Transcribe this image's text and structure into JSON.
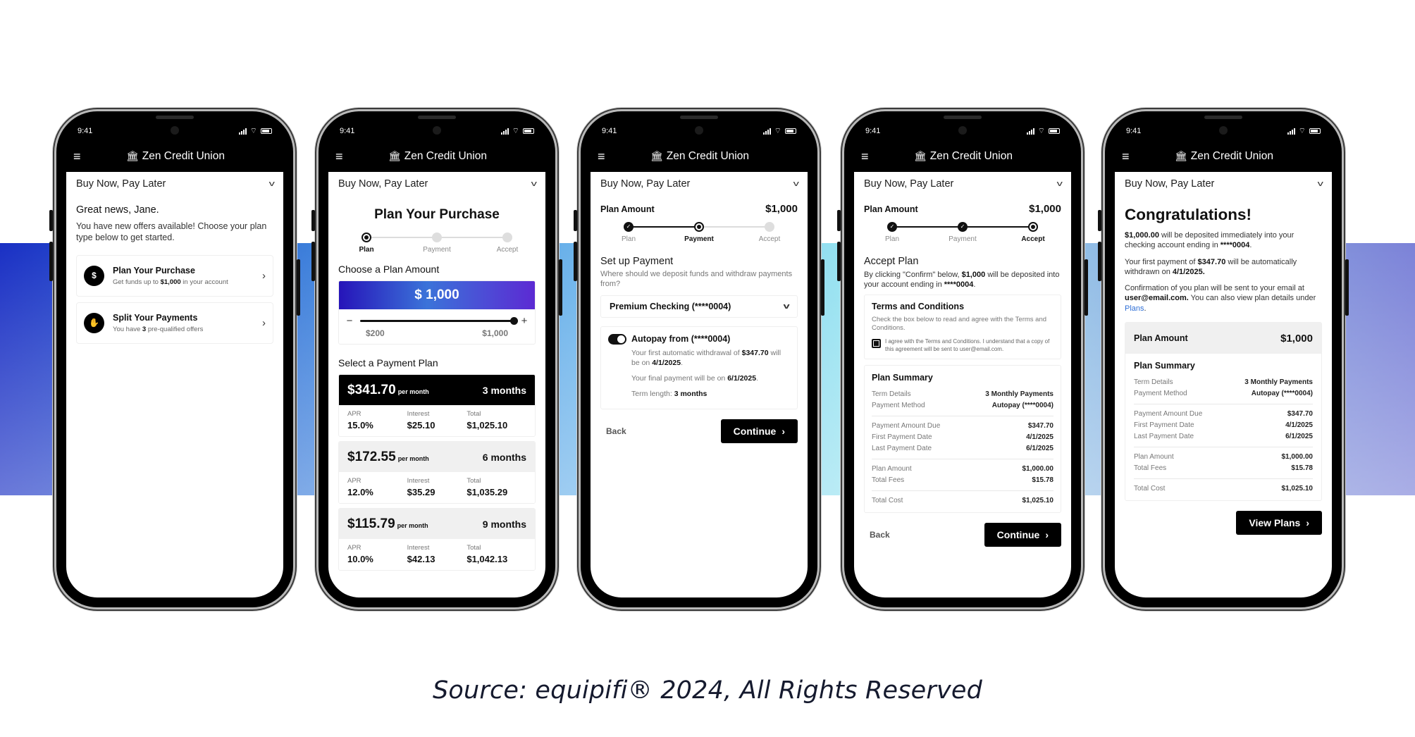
{
  "status_bar": {
    "time": "9:41",
    "icons": [
      "signal-icon",
      "wifi-icon",
      "battery-icon"
    ]
  },
  "app_bar": {
    "menu_icon": "hamburger-menu-icon",
    "brand_icon": "bank-icon",
    "brand": "Zen Credit Union"
  },
  "selector": {
    "label": "Buy Now, Pay Later",
    "icon": "chevron-down-icon"
  },
  "phone1": {
    "greeting": "Great news, Jane.",
    "subtitle": "You have new offers available! Choose your plan type below to get started.",
    "offers": [
      {
        "icon": "cash-icon",
        "title": "Plan Your Purchase",
        "desc_pre": "Get funds up to ",
        "desc_bold": "$1,000",
        "desc_post": " in your account"
      },
      {
        "icon": "hand-coin-icon",
        "title": "Split Your Payments",
        "desc_pre": "You have ",
        "desc_bold": "3",
        "desc_post": " pre-qualified offers"
      }
    ]
  },
  "steps": [
    "Plan",
    "Payment",
    "Accept"
  ],
  "phone2": {
    "title": "Plan Your Purchase",
    "current_step": "Plan",
    "choose_amount_label": "Choose a Plan Amount",
    "amount": "$ 1,000",
    "slider": {
      "min_label": "$200",
      "max_label": "$1,000",
      "min": 200,
      "max": 1000,
      "value": 1000,
      "minus": "−",
      "plus": "+"
    },
    "select_plan_label": "Select a Payment Plan",
    "per_month": "per month",
    "col_labels": {
      "apr": "APR",
      "interest": "Interest",
      "total": "Total"
    },
    "plans": [
      {
        "monthly": "$341.70",
        "term": "3 months",
        "apr": "15.0%",
        "interest": "$25.10",
        "total": "$1,025.10",
        "selected": true
      },
      {
        "monthly": "$172.55",
        "term": "6 months",
        "apr": "12.0%",
        "interest": "$35.29",
        "total": "$1,035.29",
        "selected": false
      },
      {
        "monthly": "$115.79",
        "term": "9 months",
        "apr": "10.0%",
        "interest": "$42.13",
        "total": "$1,042.13",
        "selected": false
      }
    ]
  },
  "plan_amount": {
    "label": "Plan Amount",
    "value": "$1,000"
  },
  "phone3": {
    "current_step": "Payment",
    "title": "Set up Payment",
    "desc": "Where should we deposit funds and withdraw payments from?",
    "account_select": "Premium Checking (****0004)",
    "autopay": {
      "enabled": true,
      "label": "Autopay from (****0004)",
      "line1_pre": "Your first automatic withdrawal of ",
      "line1_amount": "$347.70",
      "line1_mid": " will be on ",
      "line1_date": "4/1/2025",
      "line2_pre": "Your final payment will be on ",
      "line2_date": "6/1/2025",
      "line3_pre": "Term length: ",
      "line3_term": "3 months"
    },
    "back": "Back",
    "continue": "Continue"
  },
  "phone4": {
    "current_step": "Accept",
    "title": "Accept Plan",
    "desc_pre": "By clicking \"Confirm\" below, ",
    "desc_amount": "$1,000",
    "desc_mid": " will be deposited into your account ending in ",
    "desc_account": "****0004",
    "terms": {
      "title": "Terms and Conditions",
      "desc": "Check the box below to read and agree with the Terms and Conditions.",
      "checked": true,
      "agree": "I agree with the Terms and Conditions. I understand that a copy of this agreement will be sent to user@email.com."
    },
    "back": "Back",
    "continue": "Continue"
  },
  "summary": {
    "title": "Plan Summary",
    "groups": [
      [
        {
          "k": "Term Details",
          "v": "3 Monthly Payments"
        },
        {
          "k": "Payment Method",
          "v": "Autopay (****0004)"
        }
      ],
      [
        {
          "k": "Payment Amount Due",
          "v": "$347.70"
        },
        {
          "k": "First Payment Date",
          "v": "4/1/2025"
        },
        {
          "k": "Last Payment Date",
          "v": "6/1/2025"
        }
      ],
      [
        {
          "k": "Plan Amount",
          "v": "$1,000.00"
        },
        {
          "k": "Total Fees",
          "v": "$15.78"
        }
      ],
      [
        {
          "k": "Total Cost",
          "v": "$1,025.10"
        }
      ]
    ]
  },
  "phone5": {
    "title": "Congratulations!",
    "p1_amount": "$1,000.00",
    "p1_mid": " will be deposited immediately into your checking account ending in ",
    "p1_account": "****0004",
    "p2_pre": "Your first payment of ",
    "p2_amount": "$347.70",
    "p2_mid": " will be automatically withdrawn on ",
    "p2_date": "4/1/2025.",
    "p3_pre": "Confirmation of you plan will be sent to your email at ",
    "p3_email": "user@email.com.",
    "p3_mid": " You can also view plan details under ",
    "p3_link": "Plans",
    "view_plans": "View Plans"
  },
  "caption": "Source: equipifi® 2024, All Rights Reserved",
  "colors": {
    "band_left": "#1a30c4",
    "band_mid": "#9be8f1",
    "band_right": "#7c82d8",
    "amount_gradient_start": "#2614b9",
    "amount_gradient_end": "#5c2ad3",
    "link": "#2f6fd6",
    "primary": "#000000"
  }
}
